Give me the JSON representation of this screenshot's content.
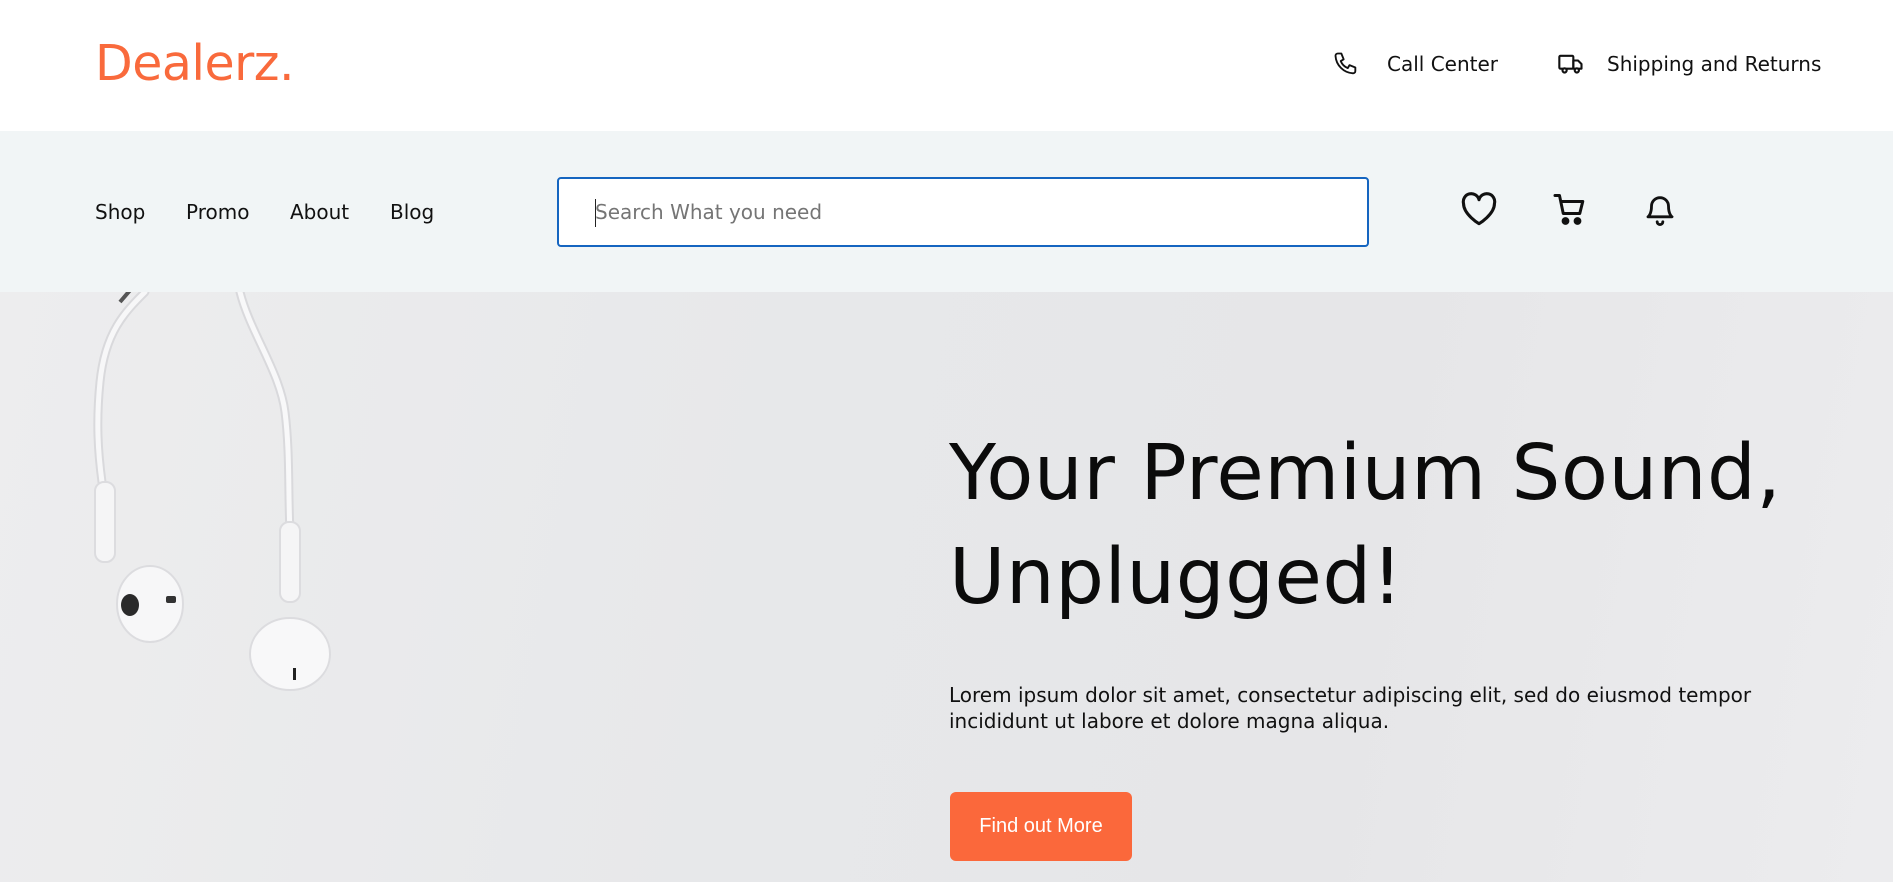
{
  "brand": {
    "logo": "Dealerz.",
    "accent_color": "#f96a3c"
  },
  "topbar": {
    "links": [
      {
        "label": "Call Center",
        "icon": "phone-icon"
      },
      {
        "label": "Shipping and Returns",
        "icon": "truck-icon"
      }
    ]
  },
  "nav": {
    "items": [
      {
        "label": "Shop"
      },
      {
        "label": "Promo"
      },
      {
        "label": "About"
      },
      {
        "label": "Blog"
      }
    ],
    "search": {
      "placeholder": "Search What you need",
      "value": ""
    },
    "icons": [
      "heart-icon",
      "cart-icon",
      "bell-icon"
    ]
  },
  "hero": {
    "title_line1": "Your Premium Sound,",
    "title_line2": "Unplugged!",
    "description": "Lorem ipsum dolor sit amet, consectetur adipiscing elit, sed do eiusmod tempor incididunt ut labore et dolore magna aliqua.",
    "cta_label": "Find out More",
    "cta_color": "#fb683b"
  }
}
